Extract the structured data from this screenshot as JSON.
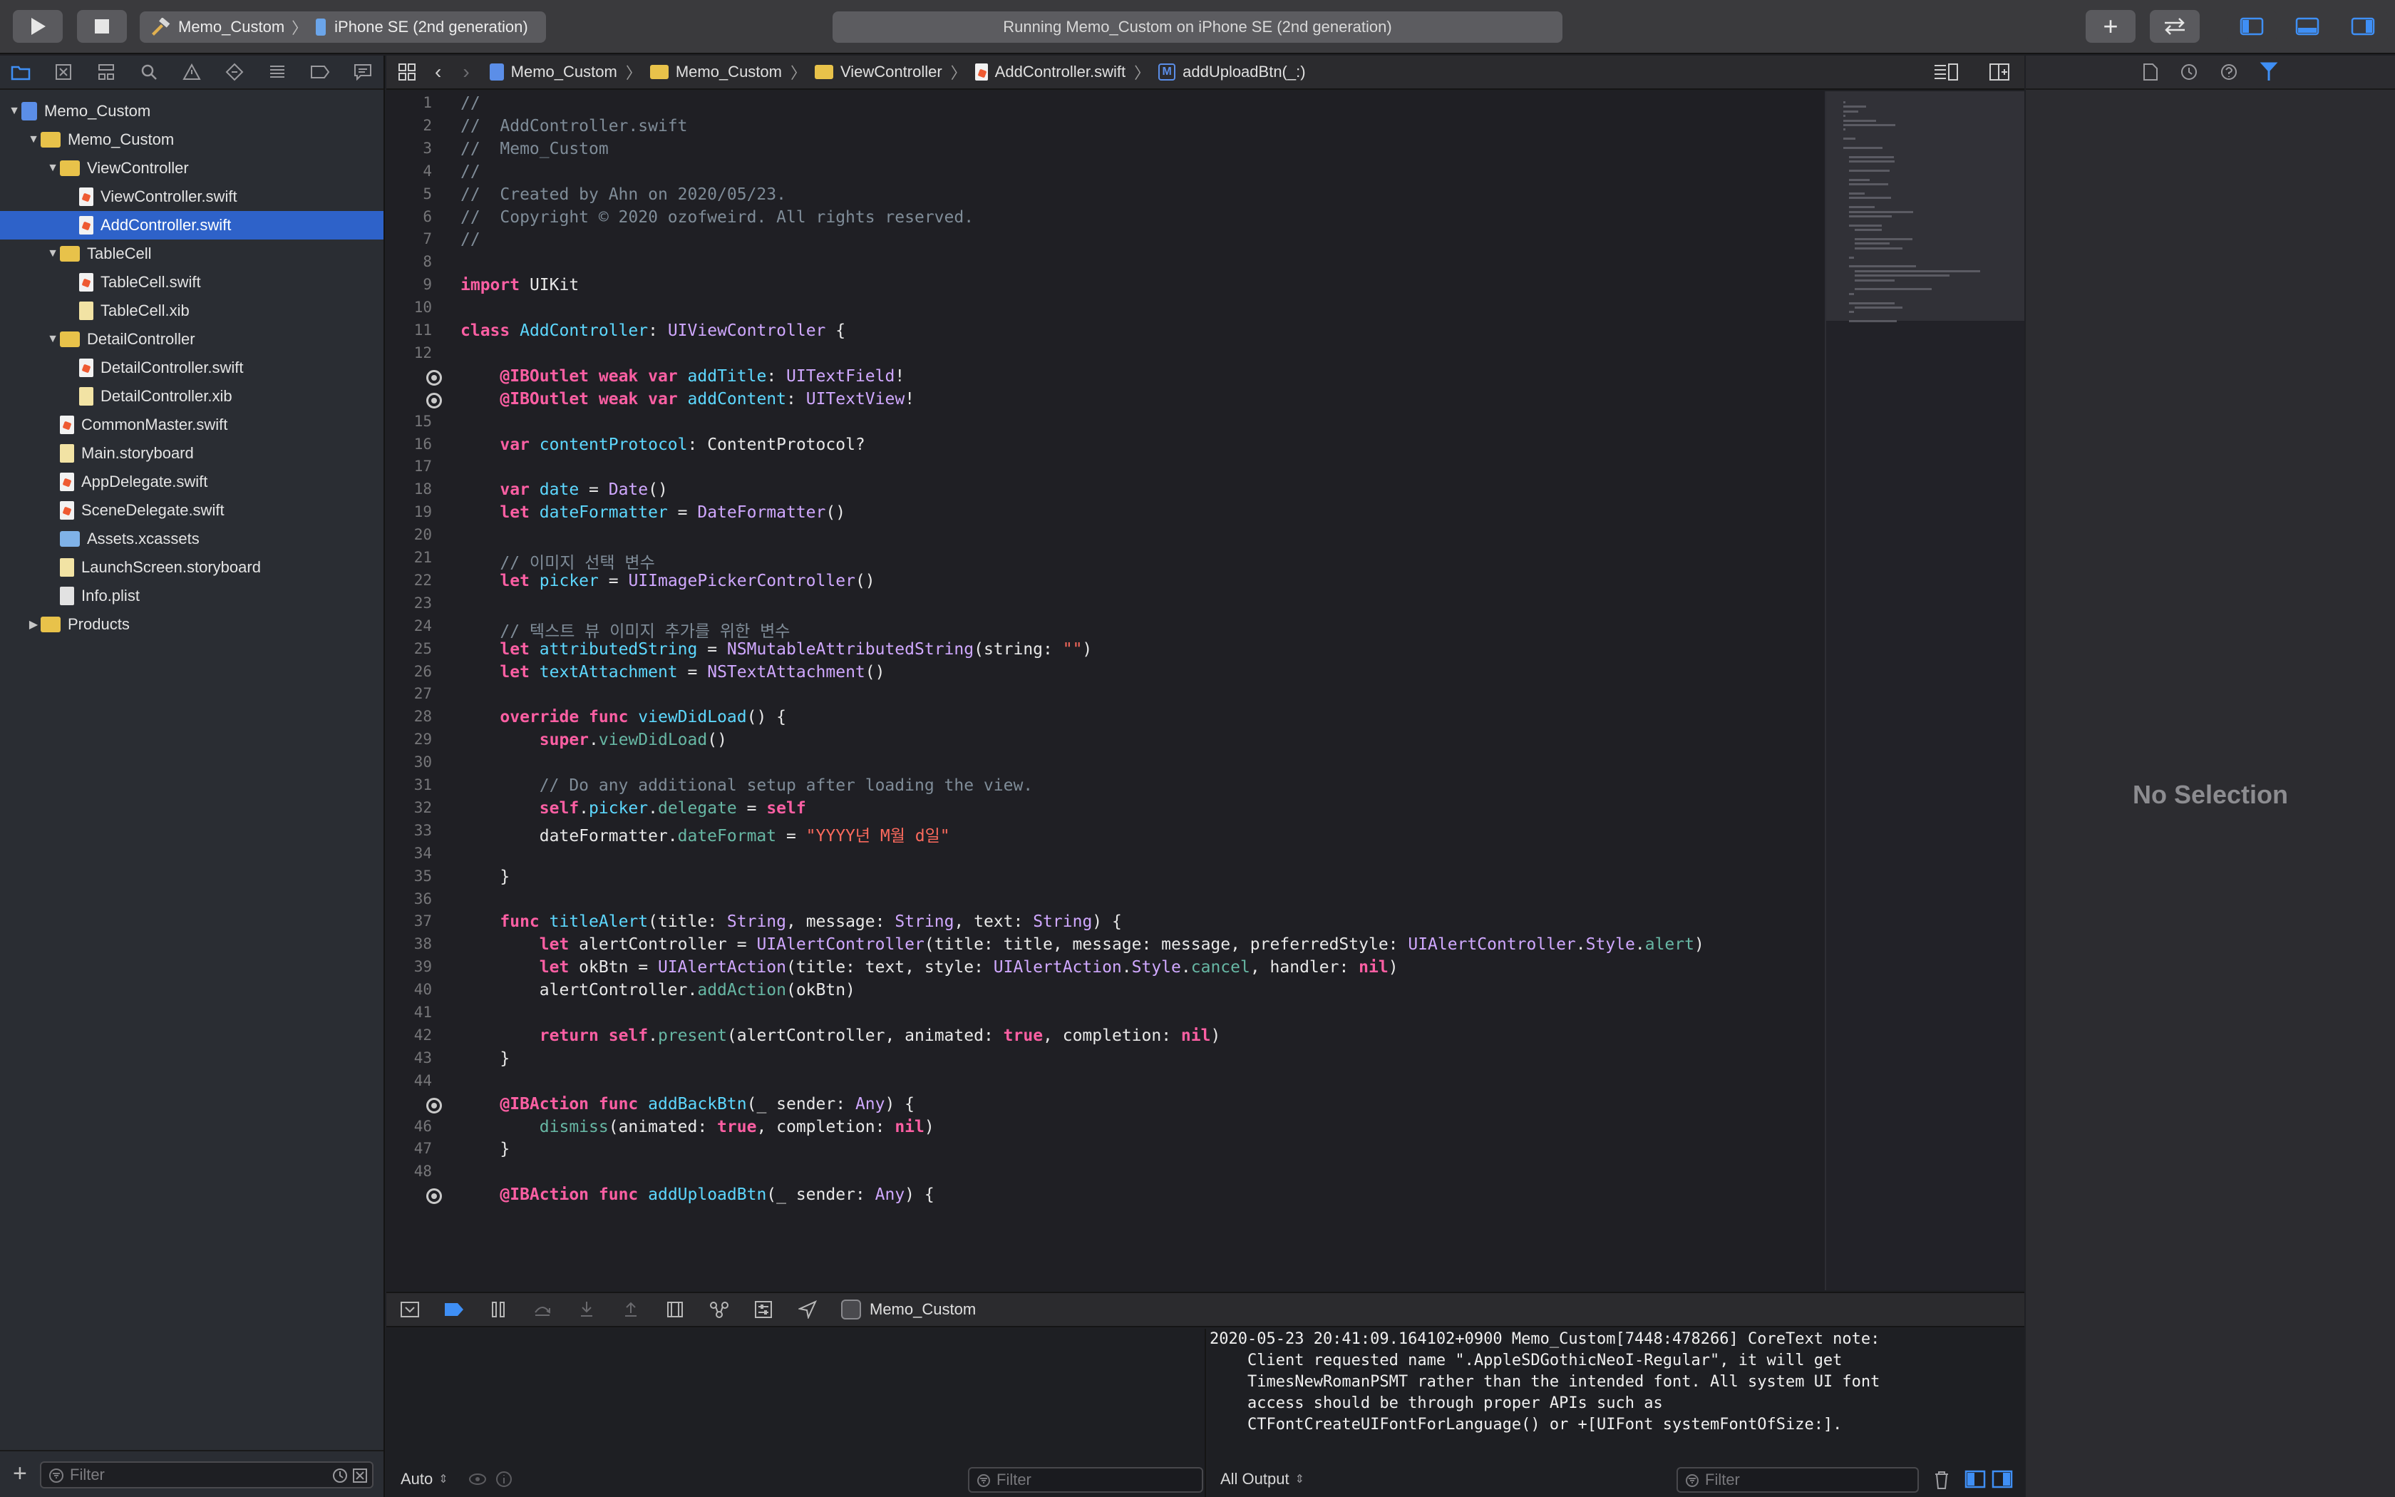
{
  "toolbar": {
    "scheme_name": "Memo_Custom",
    "device_name": "iPhone SE (2nd generation)",
    "status_text": "Running Memo_Custom on iPhone SE (2nd generation)"
  },
  "navigator": {
    "items": [
      {
        "label": "Memo_Custom",
        "depth": 0,
        "icon": "project-icon",
        "expanded": true
      },
      {
        "label": "Memo_Custom",
        "depth": 1,
        "icon": "folder-icon",
        "expanded": true
      },
      {
        "label": "ViewController",
        "depth": 2,
        "icon": "folder-icon",
        "expanded": true
      },
      {
        "label": "ViewController.swift",
        "depth": 3,
        "icon": "swift-file-icon"
      },
      {
        "label": "AddController.swift",
        "depth": 3,
        "icon": "swift-file-icon",
        "selected": true
      },
      {
        "label": "TableCell",
        "depth": 2,
        "icon": "folder-icon",
        "expanded": true
      },
      {
        "label": "TableCell.swift",
        "depth": 3,
        "icon": "swift-file-icon"
      },
      {
        "label": "TableCell.xib",
        "depth": 3,
        "icon": "xib-file-icon"
      },
      {
        "label": "DetailController",
        "depth": 2,
        "icon": "folder-icon",
        "expanded": true
      },
      {
        "label": "DetailController.swift",
        "depth": 3,
        "icon": "swift-file-icon"
      },
      {
        "label": "DetailController.xib",
        "depth": 3,
        "icon": "xib-file-icon"
      },
      {
        "label": "CommonMaster.swift",
        "depth": 2,
        "icon": "swift-file-icon"
      },
      {
        "label": "Main.storyboard",
        "depth": 2,
        "icon": "storyboard-icon"
      },
      {
        "label": "AppDelegate.swift",
        "depth": 2,
        "icon": "swift-file-icon"
      },
      {
        "label": "SceneDelegate.swift",
        "depth": 2,
        "icon": "swift-file-icon"
      },
      {
        "label": "Assets.xcassets",
        "depth": 2,
        "icon": "assets-folder-icon"
      },
      {
        "label": "LaunchScreen.storyboard",
        "depth": 2,
        "icon": "storyboard-icon"
      },
      {
        "label": "Info.plist",
        "depth": 2,
        "icon": "plist-file-icon"
      },
      {
        "label": "Products",
        "depth": 1,
        "icon": "folder-icon",
        "expanded": false
      }
    ],
    "filter_placeholder": "Filter"
  },
  "jumpbar": {
    "crumbs": [
      "Memo_Custom",
      "Memo_Custom",
      "ViewController",
      "AddController.swift",
      "addUploadBtn(_:)"
    ]
  },
  "editor": {
    "breakpoint_lines": [
      13,
      14,
      45,
      49
    ],
    "lines": [
      [
        {
          "t": "//",
          "c": "cm"
        }
      ],
      [
        {
          "t": "//  AddController.swift",
          "c": "cm"
        }
      ],
      [
        {
          "t": "//  Memo_Custom",
          "c": "cm"
        }
      ],
      [
        {
          "t": "//",
          "c": "cm"
        }
      ],
      [
        {
          "t": "//  Created by Ahn on 2020/05/23.",
          "c": "cm"
        }
      ],
      [
        {
          "t": "//  Copyright © 2020 ozofweird. All rights reserved.",
          "c": "cm"
        }
      ],
      [
        {
          "t": "//",
          "c": "cm"
        }
      ],
      [],
      [
        {
          "t": "import",
          "c": "kw"
        },
        {
          "t": " UIKit"
        }
      ],
      [],
      [
        {
          "t": "class",
          "c": "kw"
        },
        {
          "t": " "
        },
        {
          "t": "AddController",
          "c": "nm"
        },
        {
          "t": ": "
        },
        {
          "t": "UIViewController",
          "c": "ty"
        },
        {
          "t": " {"
        }
      ],
      [],
      [
        {
          "t": "    "
        },
        {
          "t": "@IBOutlet",
          "c": "kw"
        },
        {
          "t": " "
        },
        {
          "t": "weak",
          "c": "kw"
        },
        {
          "t": " "
        },
        {
          "t": "var",
          "c": "kw"
        },
        {
          "t": " "
        },
        {
          "t": "addTitle",
          "c": "nm"
        },
        {
          "t": ": "
        },
        {
          "t": "UITextField",
          "c": "ty"
        },
        {
          "t": "!"
        }
      ],
      [
        {
          "t": "    "
        },
        {
          "t": "@IBOutlet",
          "c": "kw"
        },
        {
          "t": " "
        },
        {
          "t": "weak",
          "c": "kw"
        },
        {
          "t": " "
        },
        {
          "t": "var",
          "c": "kw"
        },
        {
          "t": " "
        },
        {
          "t": "addContent",
          "c": "nm"
        },
        {
          "t": ": "
        },
        {
          "t": "UITextView",
          "c": "ty"
        },
        {
          "t": "!"
        }
      ],
      [],
      [
        {
          "t": "    "
        },
        {
          "t": "var",
          "c": "kw"
        },
        {
          "t": " "
        },
        {
          "t": "contentProtocol",
          "c": "nm"
        },
        {
          "t": ": ContentProtocol?"
        }
      ],
      [],
      [
        {
          "t": "    "
        },
        {
          "t": "var",
          "c": "kw"
        },
        {
          "t": " "
        },
        {
          "t": "date",
          "c": "nm"
        },
        {
          "t": " = "
        },
        {
          "t": "Date",
          "c": "ty"
        },
        {
          "t": "()"
        }
      ],
      [
        {
          "t": "    "
        },
        {
          "t": "let",
          "c": "kw"
        },
        {
          "t": " "
        },
        {
          "t": "dateFormatter",
          "c": "nm"
        },
        {
          "t": " = "
        },
        {
          "t": "DateFormatter",
          "c": "ty"
        },
        {
          "t": "()"
        }
      ],
      [],
      [
        {
          "t": "    // 이미지 선택 변수",
          "c": "cm"
        }
      ],
      [
        {
          "t": "    "
        },
        {
          "t": "let",
          "c": "kw"
        },
        {
          "t": " "
        },
        {
          "t": "picker",
          "c": "nm"
        },
        {
          "t": " = "
        },
        {
          "t": "UIImagePickerController",
          "c": "ty"
        },
        {
          "t": "()"
        }
      ],
      [],
      [
        {
          "t": "    // 텍스트 뷰 이미지 추가를 위한 변수",
          "c": "cm"
        }
      ],
      [
        {
          "t": "    "
        },
        {
          "t": "let",
          "c": "kw"
        },
        {
          "t": " "
        },
        {
          "t": "attributedString",
          "c": "nm"
        },
        {
          "t": " = "
        },
        {
          "t": "NSMutableAttributedString",
          "c": "ty"
        },
        {
          "t": "(string: "
        },
        {
          "t": "\"\"",
          "c": "st"
        },
        {
          "t": ")"
        }
      ],
      [
        {
          "t": "    "
        },
        {
          "t": "let",
          "c": "kw"
        },
        {
          "t": " "
        },
        {
          "t": "textAttachment",
          "c": "nm"
        },
        {
          "t": " = "
        },
        {
          "t": "NSTextAttachment",
          "c": "ty"
        },
        {
          "t": "()"
        }
      ],
      [],
      [
        {
          "t": "    "
        },
        {
          "t": "override",
          "c": "kw"
        },
        {
          "t": " "
        },
        {
          "t": "func",
          "c": "kw"
        },
        {
          "t": " "
        },
        {
          "t": "viewDidLoad",
          "c": "nm"
        },
        {
          "t": "() {"
        }
      ],
      [
        {
          "t": "        "
        },
        {
          "t": "super",
          "c": "kw"
        },
        {
          "t": "."
        },
        {
          "t": "viewDidLoad",
          "c": "pr"
        },
        {
          "t": "()"
        }
      ],
      [],
      [
        {
          "t": "        // Do any additional setup after loading the view.",
          "c": "cm"
        }
      ],
      [
        {
          "t": "        "
        },
        {
          "t": "self",
          "c": "kw"
        },
        {
          "t": "."
        },
        {
          "t": "picker",
          "c": "nm"
        },
        {
          "t": "."
        },
        {
          "t": "delegate",
          "c": "pr"
        },
        {
          "t": " = "
        },
        {
          "t": "self",
          "c": "kw"
        }
      ],
      [
        {
          "t": "        dateFormatter."
        },
        {
          "t": "dateFormat",
          "c": "pr"
        },
        {
          "t": " = "
        },
        {
          "t": "\"YYYY년 M월 d일\"",
          "c": "st"
        }
      ],
      [],
      [
        {
          "t": "    }"
        }
      ],
      [],
      [
        {
          "t": "    "
        },
        {
          "t": "func",
          "c": "kw"
        },
        {
          "t": " "
        },
        {
          "t": "titleAlert",
          "c": "nm"
        },
        {
          "t": "(title: "
        },
        {
          "t": "String",
          "c": "ty"
        },
        {
          "t": ", message: "
        },
        {
          "t": "String",
          "c": "ty"
        },
        {
          "t": ", text: "
        },
        {
          "t": "String",
          "c": "ty"
        },
        {
          "t": ") {"
        }
      ],
      [
        {
          "t": "        "
        },
        {
          "t": "let",
          "c": "kw"
        },
        {
          "t": " alertController = "
        },
        {
          "t": "UIAlertController",
          "c": "ty"
        },
        {
          "t": "(title: title, message: message, preferredStyle: "
        },
        {
          "t": "UIAlertController",
          "c": "ty"
        },
        {
          "t": "."
        },
        {
          "t": "Style",
          "c": "ty"
        },
        {
          "t": "."
        },
        {
          "t": "alert",
          "c": "pr"
        },
        {
          "t": ")"
        }
      ],
      [
        {
          "t": "        "
        },
        {
          "t": "let",
          "c": "kw"
        },
        {
          "t": " okBtn = "
        },
        {
          "t": "UIAlertAction",
          "c": "ty"
        },
        {
          "t": "(title: text, style: "
        },
        {
          "t": "UIAlertAction",
          "c": "ty"
        },
        {
          "t": "."
        },
        {
          "t": "Style",
          "c": "ty"
        },
        {
          "t": "."
        },
        {
          "t": "cancel",
          "c": "pr"
        },
        {
          "t": ", handler: "
        },
        {
          "t": "nil",
          "c": "kw"
        },
        {
          "t": ")"
        }
      ],
      [
        {
          "t": "        alertController."
        },
        {
          "t": "addAction",
          "c": "pr"
        },
        {
          "t": "(okBtn)"
        }
      ],
      [],
      [
        {
          "t": "        "
        },
        {
          "t": "return",
          "c": "kw"
        },
        {
          "t": " "
        },
        {
          "t": "self",
          "c": "kw"
        },
        {
          "t": "."
        },
        {
          "t": "present",
          "c": "pr"
        },
        {
          "t": "(alertController, animated: "
        },
        {
          "t": "true",
          "c": "kw"
        },
        {
          "t": ", completion: "
        },
        {
          "t": "nil",
          "c": "kw"
        },
        {
          "t": ")"
        }
      ],
      [
        {
          "t": "    }"
        }
      ],
      [],
      [
        {
          "t": "    "
        },
        {
          "t": "@IBAction",
          "c": "kw"
        },
        {
          "t": " "
        },
        {
          "t": "func",
          "c": "kw"
        },
        {
          "t": " "
        },
        {
          "t": "addBackBtn",
          "c": "nm"
        },
        {
          "t": "(_ sender: "
        },
        {
          "t": "Any",
          "c": "ty"
        },
        {
          "t": ") {"
        }
      ],
      [
        {
          "t": "        "
        },
        {
          "t": "dismiss",
          "c": "pr"
        },
        {
          "t": "(animated: "
        },
        {
          "t": "true",
          "c": "kw"
        },
        {
          "t": ", completion: "
        },
        {
          "t": "nil",
          "c": "kw"
        },
        {
          "t": ")"
        }
      ],
      [
        {
          "t": "    }"
        }
      ],
      [],
      [
        {
          "t": "    "
        },
        {
          "t": "@IBAction",
          "c": "kw"
        },
        {
          "t": " "
        },
        {
          "t": "func",
          "c": "kw"
        },
        {
          "t": " "
        },
        {
          "t": "addUploadBtn",
          "c": "nm"
        },
        {
          "t": "(_ sender: "
        },
        {
          "t": "Any",
          "c": "ty"
        },
        {
          "t": ") {"
        }
      ]
    ]
  },
  "debug": {
    "target_label": "Memo_Custom",
    "variables_mode": "Auto",
    "variables_filter_placeholder": "Filter",
    "console_output_mode": "All Output",
    "console_filter_placeholder": "Filter",
    "console_text": "2020-05-23 20:41:09.164102+0900 Memo_Custom[7448:478266] CoreText note:\n    Client requested name \".AppleSDGothicNeoI-Regular\", it will get\n    TimesNewRomanPSMT rather than the intended font. All system UI font\n    access should be through proper APIs such as\n    CTFontCreateUIFontForLanguage() or +[UIFont systemFontOfSize:]."
  },
  "inspector": {
    "empty_label": "No Selection"
  },
  "colors": {
    "accent": "#2e62c9",
    "keyword": "#fc5fa3",
    "comment": "#7f8c98",
    "type": "#d0a8ff",
    "string": "#fc6a5d"
  }
}
